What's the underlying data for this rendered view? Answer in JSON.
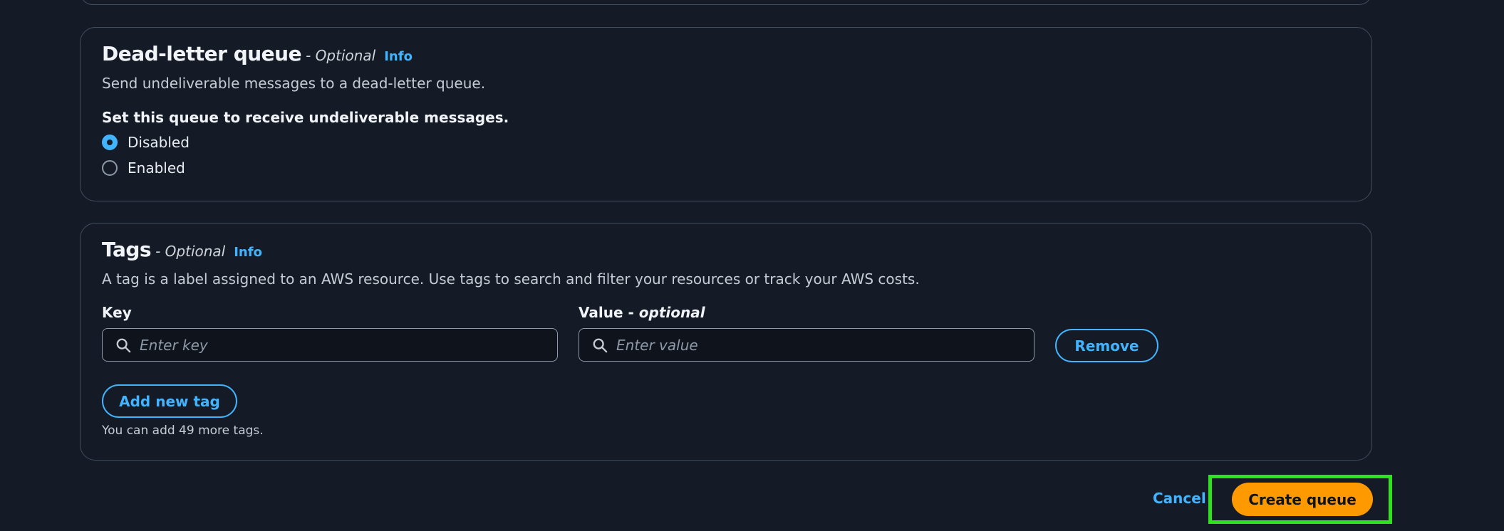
{
  "dead_letter_queue": {
    "title": "Dead-letter queue",
    "optional": "- Optional",
    "info": "Info",
    "description": "Send undeliverable messages to a dead-letter queue.",
    "question": "Set this queue to receive undeliverable messages.",
    "options": [
      {
        "label": "Disabled",
        "selected": true
      },
      {
        "label": "Enabled",
        "selected": false
      }
    ]
  },
  "tags": {
    "title": "Tags",
    "optional": "- Optional",
    "info": "Info",
    "description": "A tag is a label assigned to an AWS resource. Use tags to search and filter your resources or track your AWS costs.",
    "key_label": "Key",
    "value_label": "Value -",
    "value_label_optional": "optional",
    "key_placeholder": "Enter key",
    "value_placeholder": "Enter value",
    "remove_label": "Remove",
    "add_label": "Add new tag",
    "hint": "You can add 49 more tags."
  },
  "footer": {
    "cancel_label": "Cancel",
    "create_label": "Create queue"
  },
  "colors": {
    "accent": "#42b4ff",
    "primary_button": "#ff9900",
    "highlight": "#2ee31c",
    "background": "#151b26"
  }
}
